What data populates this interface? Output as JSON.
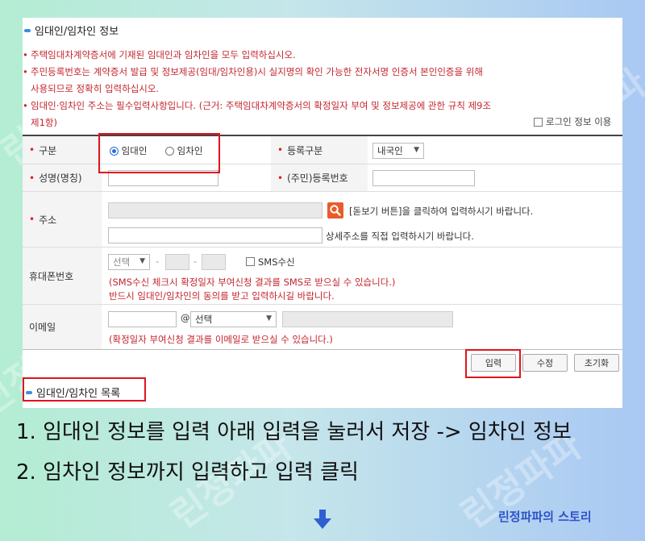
{
  "watermark": "린정파파",
  "section_info": {
    "title": "임대인/임차인 정보"
  },
  "notices": [
    {
      "mark": "•",
      "text": "주택임대차계약증서에 기재된 임대인과 임차인을 모두 입력하십시오."
    },
    {
      "mark": "•",
      "text": "주민등록번호는 계약증서 발급 및 정보제공(임대/임차인용)시 실지명의 확인 가능한 전자서명 인증서 본인인증을 위해"
    },
    {
      "mark": "",
      "text": "사용되므로 정확히 입력하십시오."
    },
    {
      "mark": "•",
      "text": "임대인·임차인 주소는 필수입력사항입니다. (근거: 주택임대차계약증서의 확정일자 부여 및 정보제공에 관한 규칙 제9조"
    },
    {
      "mark": "",
      "text": "제1항)"
    }
  ],
  "login_info_checkbox": "로그인 정보 이용",
  "form": {
    "type_label": "구분",
    "type_options": [
      "임대인",
      "임차인"
    ],
    "type_selected": "임대인",
    "reg_type_label": "등록구분",
    "reg_type_value": "내국인",
    "name_label": "성명(명칭)",
    "id_label": "(주민)등록번호",
    "address_label": "주소",
    "address_help": "[돋보기 버튼]을 클릭하여 입력하시기 바랍니다.",
    "address_detail_help": "상세주소를 직접 입력하시기 바랍니다.",
    "phone_label": "휴대폰번호",
    "phone_prefix": "선택",
    "phone_dash": "-",
    "sms_label": "SMS수신",
    "sms_note1": "(SMS수신 체크시 확정일자 부여신청 결과를 SMS로 받으실 수 있습니다.)",
    "sms_note2": "반드시 임대인/임차인의 동의를 받고 입력하시길 바랍니다.",
    "email_label": "이메일",
    "email_at": "@",
    "email_domain": "선택",
    "email_note": "(확정일자 부여신청 결과를 이메일로 받으실 수 있습니다.)"
  },
  "buttons": {
    "enter": "입력",
    "edit": "수정",
    "reset": "초기화"
  },
  "section_list": {
    "title": "임대인/임차인 목록"
  },
  "instructions": [
    "1. 임대인 정보를 입력 아래 입력을 눌러서 저장 -> 임차인 정보",
    "2. 임차인 정보까지 입력하고 입력 클릭"
  ],
  "brand": "린정파파의 스토리",
  "colors": {
    "highlight": "#e0141e",
    "notice_text": "#c4262e",
    "brand": "#2f52c9",
    "arrow": "#2f5fd0"
  }
}
